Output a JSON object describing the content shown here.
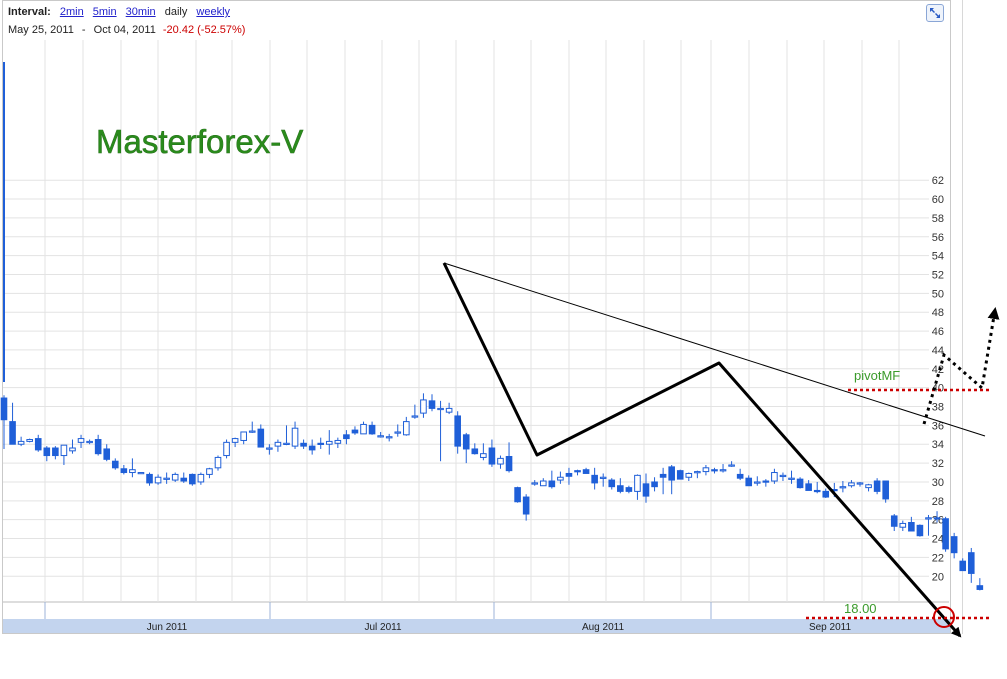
{
  "header": {
    "interval_label": "Interval:",
    "intervals": [
      "2min",
      "5min",
      "30min",
      "daily",
      "weekly"
    ],
    "active_interval": "daily",
    "date_from": "May 25, 2011",
    "range_sep": "-",
    "date_to": "Oct 04, 2011",
    "change": "-20.42 (-52.57%)"
  },
  "expand_icon": "expand-icon",
  "watermark": "Masterforex-V",
  "annotations": {
    "pivot_label": "pivotMF",
    "target_label": "18.00"
  },
  "colors": {
    "candle_blue": "#1f5fd8",
    "grid": "#e3e3e3",
    "axis_bar": "#c3d4ee",
    "trendline_bold": "#000000",
    "dotted_red": "#cc0000",
    "watermark_green": "#2a8a1c",
    "label_green": "#3a9a2a"
  },
  "chart_data": {
    "type": "candlestick",
    "y_axis": {
      "min": 18,
      "max": 62,
      "step": 2,
      "ticks": [
        20,
        22,
        24,
        26,
        28,
        30,
        32,
        34,
        36,
        38,
        40,
        42,
        44,
        46,
        48,
        50,
        52,
        54,
        56,
        58,
        60,
        62
      ]
    },
    "x_labels": [
      "Jun 2011",
      "Jul 2011",
      "Aug 2011",
      "Sep 2011"
    ],
    "candles": [
      [
        38.9,
        39.2,
        33.5,
        36.6
      ],
      [
        36.4,
        38.4,
        34.0,
        34.0
      ],
      [
        34.0,
        34.8,
        33.8,
        34.3
      ],
      [
        34.3,
        34.6,
        34.2,
        34.5
      ],
      [
        34.6,
        35.0,
        33.2,
        33.4
      ],
      [
        33.6,
        33.8,
        32.2,
        32.8
      ],
      [
        33.6,
        33.8,
        32.4,
        32.8
      ],
      [
        32.8,
        33.9,
        31.8,
        33.9
      ],
      [
        33.3,
        34.5,
        33.0,
        33.6
      ],
      [
        34.2,
        35.0,
        33.6,
        34.6
      ],
      [
        34.2,
        34.5,
        34.0,
        34.3
      ],
      [
        34.5,
        35.0,
        32.8,
        33.0
      ],
      [
        33.5,
        34.0,
        32.2,
        32.4
      ],
      [
        32.2,
        32.5,
        31.3,
        31.5
      ],
      [
        31.4,
        31.8,
        30.8,
        31.0
      ],
      [
        31.0,
        32.5,
        30.5,
        31.3
      ],
      [
        31.0,
        31.0,
        31.0,
        31.0
      ],
      [
        30.8,
        31.0,
        29.6,
        29.9
      ],
      [
        29.9,
        30.8,
        29.7,
        30.5
      ],
      [
        30.4,
        31.0,
        29.8,
        30.4
      ],
      [
        30.2,
        31.0,
        30.0,
        30.8
      ],
      [
        30.4,
        31.0,
        29.9,
        30.1
      ],
      [
        30.8,
        30.9,
        29.6,
        29.8
      ],
      [
        30.0,
        31.0,
        29.7,
        30.8
      ],
      [
        30.8,
        31.5,
        30.4,
        31.4
      ],
      [
        31.5,
        32.8,
        31.2,
        32.6
      ],
      [
        32.8,
        34.5,
        32.5,
        34.2
      ],
      [
        34.2,
        34.7,
        33.7,
        34.6
      ],
      [
        34.4,
        35.3,
        34.0,
        35.3
      ],
      [
        35.4,
        36.4,
        35.2,
        35.4
      ],
      [
        35.6,
        36.1,
        33.7,
        33.7
      ],
      [
        33.5,
        34.0,
        32.9,
        33.6
      ],
      [
        33.8,
        34.5,
        33.2,
        34.2
      ],
      [
        34.0,
        36.0,
        33.9,
        34.1
      ],
      [
        33.8,
        36.4,
        33.5,
        35.7
      ],
      [
        34.1,
        34.5,
        33.5,
        33.8
      ],
      [
        33.8,
        34.5,
        32.9,
        33.4
      ],
      [
        34.1,
        34.7,
        33.5,
        34.0
      ],
      [
        34.0,
        35.5,
        32.9,
        34.3
      ],
      [
        34.1,
        34.7,
        33.6,
        34.4
      ],
      [
        35.0,
        35.5,
        34.0,
        34.6
      ],
      [
        35.5,
        35.9,
        35.0,
        35.2
      ],
      [
        35.1,
        36.4,
        35.1,
        36.1
      ],
      [
        36.0,
        36.4,
        35.0,
        35.1
      ],
      [
        34.8,
        35.3,
        34.7,
        34.9
      ],
      [
        34.8,
        35.1,
        34.3,
        34.8
      ],
      [
        35.3,
        36.1,
        34.8,
        35.3
      ],
      [
        35.0,
        36.9,
        34.9,
        36.4
      ],
      [
        36.9,
        38.2,
        36.7,
        37.0
      ],
      [
        37.3,
        39.4,
        36.8,
        38.7
      ],
      [
        38.6,
        39.3,
        37.5,
        37.8
      ],
      [
        37.8,
        38.6,
        32.2,
        37.8
      ],
      [
        37.4,
        38.4,
        37.2,
        37.8
      ],
      [
        37.0,
        37.5,
        33.0,
        33.8
      ],
      [
        35.0,
        35.2,
        32.0,
        33.5
      ],
      [
        33.5,
        34.1,
        32.9,
        33.0
      ],
      [
        32.6,
        34.1,
        32.3,
        33.0
      ],
      [
        33.6,
        34.5,
        31.6,
        31.9
      ],
      [
        31.9,
        32.8,
        31.4,
        32.5
      ],
      [
        32.7,
        34.2,
        31.0,
        31.2
      ],
      [
        29.4,
        29.5,
        27.8,
        27.9
      ],
      [
        28.4,
        28.7,
        25.9,
        26.6
      ],
      [
        29.8,
        30.2,
        29.6,
        29.9
      ],
      [
        29.6,
        30.4,
        29.6,
        30.1
      ],
      [
        30.1,
        31.2,
        29.3,
        29.5
      ],
      [
        30.2,
        31.1,
        29.8,
        30.5
      ],
      [
        30.9,
        31.5,
        29.7,
        30.6
      ],
      [
        31.2,
        31.3,
        30.7,
        31.1
      ],
      [
        31.3,
        31.5,
        30.9,
        30.9
      ],
      [
        30.7,
        31.5,
        29.2,
        29.9
      ],
      [
        30.4,
        30.9,
        29.5,
        30.5
      ],
      [
        30.2,
        30.4,
        29.2,
        29.5
      ],
      [
        29.6,
        30.4,
        28.8,
        29.0
      ],
      [
        29.4,
        29.6,
        28.8,
        29.0
      ],
      [
        29.0,
        30.8,
        28.1,
        30.7
      ],
      [
        29.8,
        30.9,
        27.8,
        28.5
      ],
      [
        30.0,
        30.5,
        29.0,
        29.5
      ],
      [
        30.8,
        31.5,
        28.7,
        30.5
      ],
      [
        31.6,
        31.8,
        28.7,
        30.2
      ],
      [
        31.2,
        31.3,
        30.3,
        30.3
      ],
      [
        30.5,
        31.0,
        30.1,
        30.9
      ],
      [
        31.0,
        31.2,
        30.4,
        31.1
      ],
      [
        31.1,
        31.8,
        30.7,
        31.5
      ],
      [
        31.3,
        31.5,
        30.9,
        31.2
      ],
      [
        31.2,
        31.9,
        31.0,
        31.3
      ],
      [
        31.7,
        32.2,
        31.6,
        31.8
      ],
      [
        30.8,
        31.4,
        30.2,
        30.4
      ],
      [
        30.4,
        30.7,
        29.6,
        29.6
      ],
      [
        30.0,
        30.6,
        29.6,
        30.0
      ],
      [
        30.1,
        30.3,
        29.5,
        30.0
      ],
      [
        30.1,
        31.4,
        29.8,
        31.0
      ],
      [
        30.7,
        31.0,
        30.1,
        30.7
      ],
      [
        30.4,
        31.2,
        29.8,
        30.4
      ],
      [
        30.3,
        30.5,
        29.3,
        29.4
      ],
      [
        29.8,
        30.2,
        29.1,
        29.1
      ],
      [
        29.1,
        30.0,
        28.8,
        29.0
      ],
      [
        29.0,
        29.3,
        28.3,
        28.4
      ],
      [
        29.2,
        29.9,
        28.4,
        29.1
      ],
      [
        29.4,
        30.1,
        28.9,
        29.5
      ],
      [
        29.6,
        30.2,
        29.4,
        29.9
      ],
      [
        29.8,
        30.0,
        29.5,
        29.9
      ],
      [
        29.4,
        29.8,
        29.0,
        29.7
      ],
      [
        30.1,
        30.4,
        28.7,
        29.0
      ],
      [
        30.1,
        30.1,
        27.8,
        28.2
      ],
      [
        26.4,
        26.6,
        24.8,
        25.3
      ],
      [
        25.2,
        25.9,
        24.8,
        25.6
      ],
      [
        25.7,
        26.3,
        24.8,
        24.8
      ],
      [
        25.4,
        25.5,
        24.2,
        24.3
      ],
      [
        26.2,
        26.5,
        24.3,
        26.2
      ],
      [
        26.2,
        26.9,
        25.7,
        26.1
      ],
      [
        26.1,
        26.3,
        22.6,
        22.9
      ],
      [
        24.2,
        24.6,
        21.9,
        22.5
      ],
      [
        21.6,
        21.9,
        20.6,
        20.6
      ],
      [
        22.5,
        23.0,
        19.3,
        20.3
      ],
      [
        19.0,
        19.8,
        18.5,
        18.6
      ]
    ],
    "candle_notes": "each candle is [open, high, low, close] in price units; 111 daily sessions from May 25 to Oct 04, 2011; filled = close below open"
  }
}
